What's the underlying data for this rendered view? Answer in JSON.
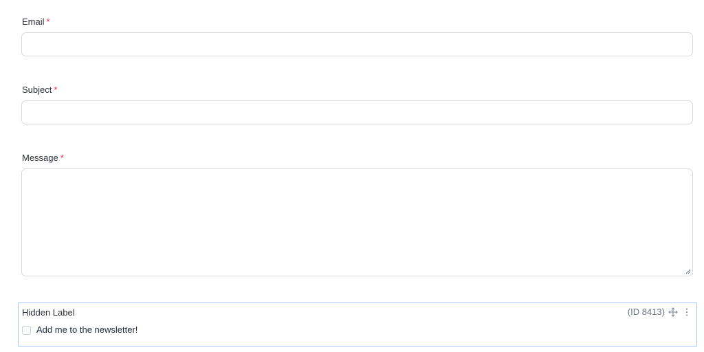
{
  "form": {
    "email": {
      "label": "Email",
      "required_mark": "*",
      "value": "",
      "placeholder": ""
    },
    "subject": {
      "label": "Subject",
      "required_mark": "*",
      "value": "",
      "placeholder": ""
    },
    "message": {
      "label": "Message",
      "required_mark": "*",
      "value": "",
      "placeholder": ""
    },
    "newsletter_field": {
      "label": "Hidden Label",
      "field_id": "(ID 8413)",
      "checkbox_label": "Add me to the newsletter!",
      "checked": false,
      "move_icon": "move-icon",
      "menu_icon": "vertical-dots-icon"
    }
  },
  "colors": {
    "required": "#dc3545",
    "selected_border": "#a9c7ee",
    "input_border": "#d7dbe0"
  }
}
